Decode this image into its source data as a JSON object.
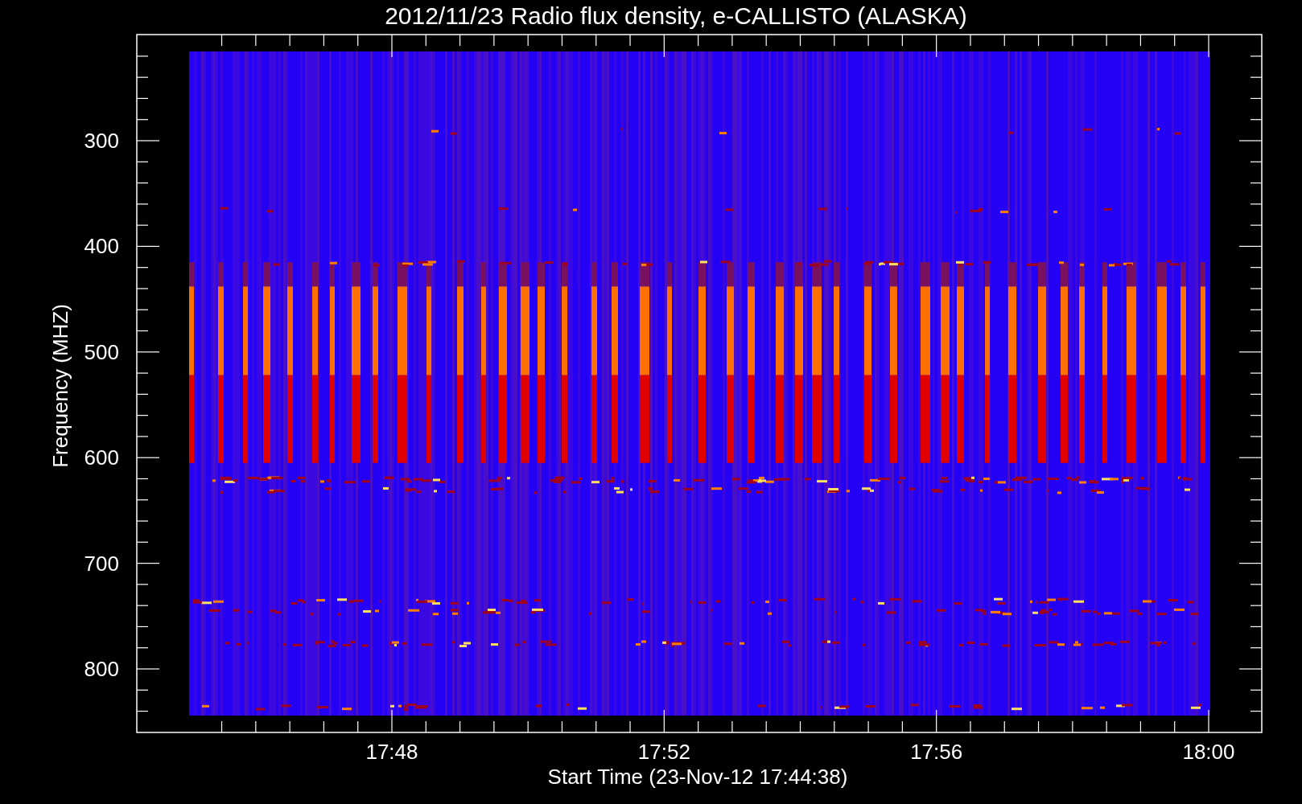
{
  "title": "2012/11/23  Radio flux density, e-CALLISTO (ALASKA)",
  "y_axis": {
    "label": "Frequency (MHZ)",
    "ticks": [
      "300",
      "400",
      "500",
      "600",
      "700",
      "800"
    ]
  },
  "x_axis": {
    "label": "Start Time (23-Nov-12 17:44:38)",
    "ticks": [
      "17:48",
      "17:52",
      "17:56",
      "18:00"
    ]
  }
}
